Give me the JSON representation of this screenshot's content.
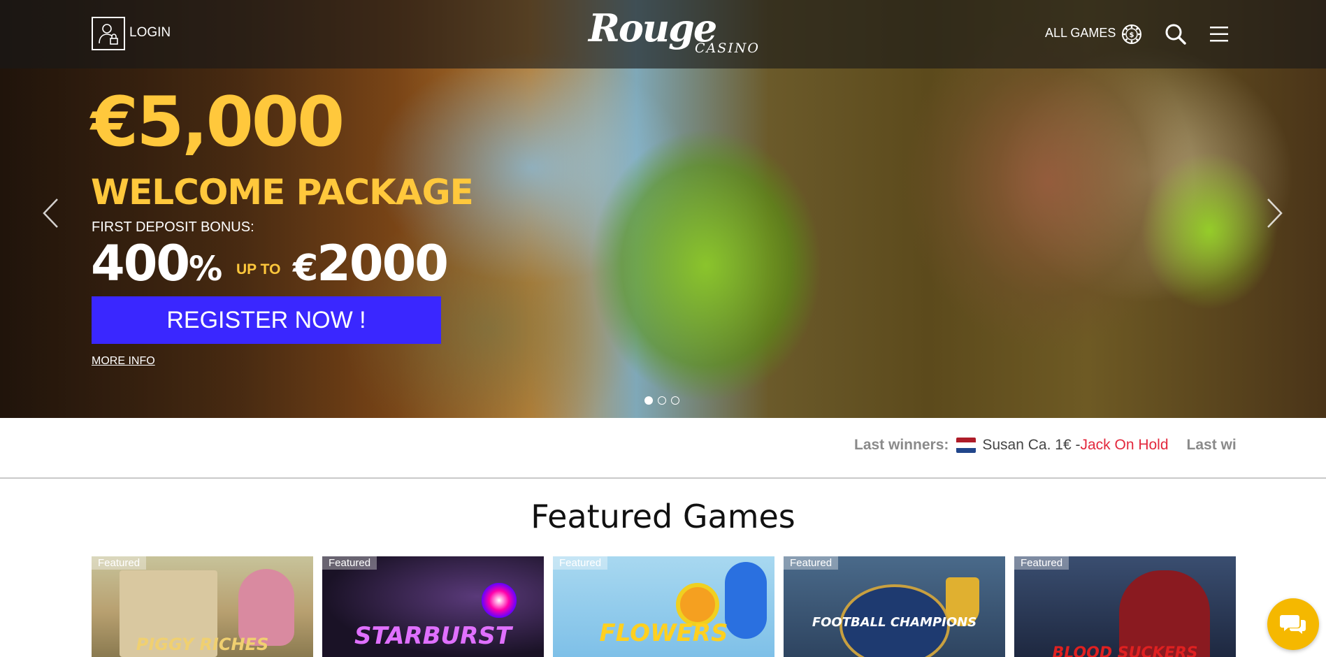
{
  "header": {
    "login_label": "LOGIN",
    "logo_main": "Rouge",
    "logo_sub": "CASINO",
    "all_games_label": "ALL GAMES",
    "icons": [
      "user-lock-icon",
      "chip-icon",
      "search-icon",
      "hamburger-menu-icon"
    ]
  },
  "hero": {
    "amount": "€5,000",
    "headline": "WELCOME PACKAGE",
    "first_deposit": "FIRST DEPOSIT BONUS:",
    "percent": "400",
    "percent_sign": "%",
    "up_to": "UP TO",
    "bonus_currency": "€",
    "bonus_amount": "2000",
    "cta": "REGISTER NOW !",
    "more_info": "MORE INFO",
    "slides": 3,
    "active_slide": 1,
    "colors": {
      "accent": "#ffc83c",
      "cta": "#3a27ff"
    }
  },
  "winners": {
    "label": "Last winners:",
    "entries": [
      {
        "flag": "netherlands",
        "name": "Susan Ca. 1€ - ",
        "game": "Jack On Hold"
      }
    ],
    "label_repeat": "Last winners:"
  },
  "featured": {
    "title": "Featured Games",
    "games": [
      {
        "badge": "Featured",
        "logo": "PIGGY RICHES",
        "bg": "#9fb07a"
      },
      {
        "badge": "Featured",
        "logo": "STARBURST",
        "bg": "#241a3a"
      },
      {
        "badge": "Featured",
        "logo": "FLOWERS",
        "bg": "#8fc7e8"
      },
      {
        "badge": "Featured",
        "logo": "FOOTBALL CHAMPIONS",
        "bg": "#3a5270"
      },
      {
        "badge": "Featured",
        "logo": "BLOOD SUCKERS",
        "bg": "#2f3d5a"
      }
    ]
  },
  "chat": {
    "icon": "chat-icon",
    "color": "#f5b800"
  }
}
